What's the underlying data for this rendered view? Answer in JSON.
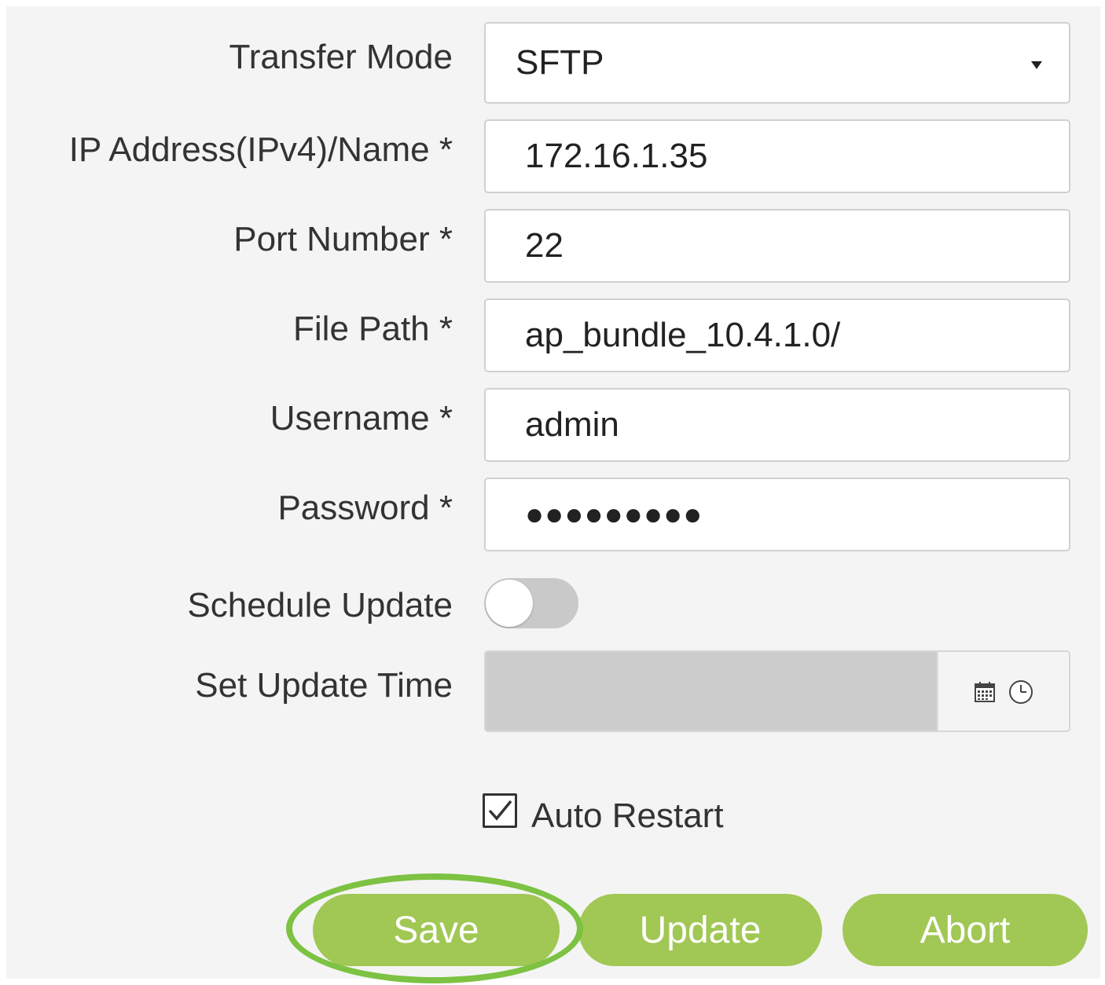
{
  "form": {
    "transfer_mode": {
      "label": "Transfer Mode",
      "value": "SFTP"
    },
    "ip_address": {
      "label": "IP Address(IPv4)/Name *",
      "value": "172.16.1.35"
    },
    "port_number": {
      "label": "Port Number *",
      "value": "22"
    },
    "file_path": {
      "label": "File Path *",
      "value": "ap_bundle_10.4.1.0/"
    },
    "username": {
      "label": "Username *",
      "value": "admin"
    },
    "password": {
      "label": "Password *",
      "masked_value": "●●●●●●●●●"
    },
    "schedule_update": {
      "label": "Schedule Update",
      "enabled": false
    },
    "set_update_time": {
      "label": "Set Update Time",
      "value": "",
      "disabled": true
    },
    "auto_restart": {
      "label": "Auto Restart",
      "checked": true
    }
  },
  "buttons": {
    "save": "Save",
    "update": "Update",
    "abort": "Abort"
  },
  "icons": {
    "dropdown": "caret-down-icon",
    "calendar": "calendar-icon",
    "clock": "clock-icon",
    "check": "checkmark-icon"
  },
  "colors": {
    "button_green": "#a1c754",
    "highlight_ring": "#7dc242",
    "toggle_off": "#c9c9c9",
    "disabled_field": "#cccccc"
  }
}
